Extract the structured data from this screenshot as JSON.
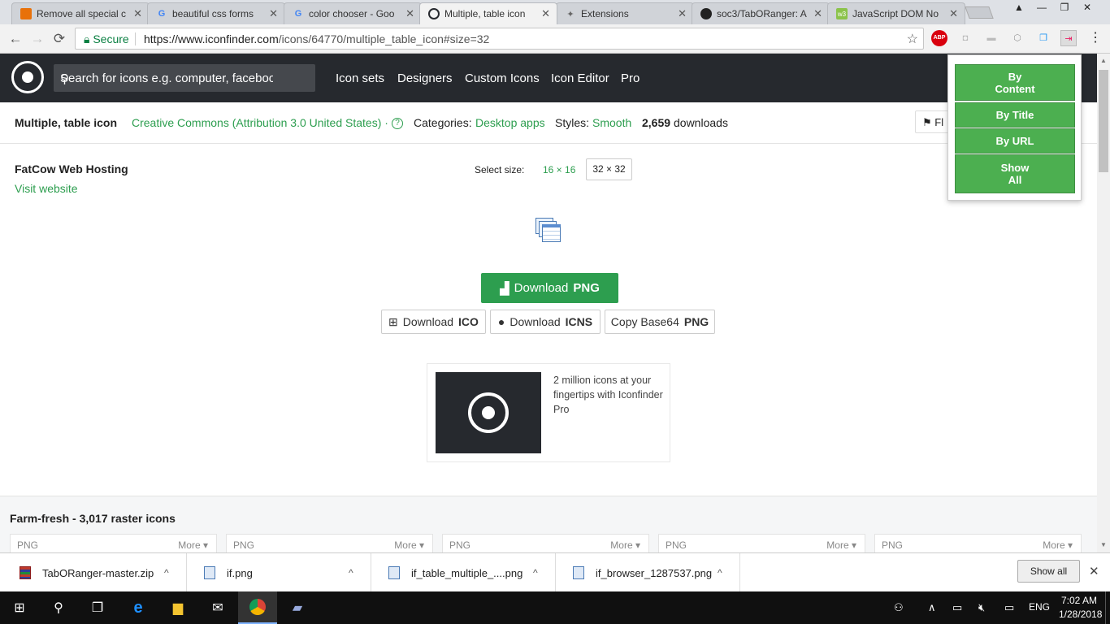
{
  "tabs": [
    {
      "label": "Remove all special c",
      "favicon": "",
      "color": "#e8710a"
    },
    {
      "label": "beautiful css forms",
      "favicon": "G",
      "color": "#4285f4"
    },
    {
      "label": "color chooser - Goo",
      "favicon": "G",
      "color": "#4285f4"
    },
    {
      "label": "Multiple, table icon",
      "favicon": "",
      "color": "#26292e"
    },
    {
      "label": "Extensions",
      "favicon": "✦",
      "color": "#666666"
    },
    {
      "label": "soc3/TabORanger: A",
      "favicon": "",
      "color": "#222222"
    },
    {
      "label": "JavaScript DOM No",
      "favicon": "w3",
      "color": "#8bc34a"
    }
  ],
  "window": {
    "minimize": "—",
    "maximize": "❐",
    "close": "✕"
  },
  "toolbar": {
    "back": "←",
    "forward": "→",
    "reload": "⟳",
    "secure_label": "Secure",
    "url_host": "https://www.iconfinder.com",
    "url_path": "/icons/64770/multiple_table_icon#size=32",
    "star": "☆",
    "abp": "ABP",
    "menu": "⋮"
  },
  "site": {
    "search_placeholder": "Search for icons e.g. computer, faceboo",
    "nav": [
      "Icon sets",
      "Designers",
      "Custom Icons",
      "Icon Editor",
      "Pro"
    ]
  },
  "info": {
    "icon_title": "Multiple, table icon",
    "license": "Creative Commons (Attribution 3.0 United States) ·",
    "help": "?",
    "categories_label": "Categories:",
    "categories_value": "Desktop apps",
    "styles_label": "Styles:",
    "styles_value": "Smooth",
    "downloads_count": "2,659",
    "downloads_label": "downloads",
    "flag_label": "Fl"
  },
  "author": {
    "name": "FatCow Web Hosting",
    "link": "Visit website"
  },
  "size": {
    "label": "Select size:",
    "options": [
      "16 × 16",
      "32 × 32"
    ],
    "selected": "32 × 32"
  },
  "downloads": {
    "png_prefix": "Download",
    "png_bold": "PNG",
    "ico_prefix": "Download",
    "ico_bold": "ICO",
    "icns_prefix": "Download",
    "icns_bold": "ICNS",
    "base64_prefix": "Copy Base64",
    "base64_bold": "PNG"
  },
  "promo": {
    "text": "2 million icons at your fingertips with Iconfinder Pro"
  },
  "iconset": {
    "title_name": "Farm-fresh",
    "title_rest": " - 3,017 raster icons",
    "cards": [
      {
        "type": "PNG",
        "more": "More"
      },
      {
        "type": "PNG",
        "more": "More"
      },
      {
        "type": "PNG",
        "more": "More"
      },
      {
        "type": "PNG",
        "more": "More"
      },
      {
        "type": "PNG",
        "more": "More"
      }
    ]
  },
  "popup": {
    "buttons": [
      "By Content",
      "By Title",
      "By URL",
      "Show All"
    ]
  },
  "download_bar": {
    "items": [
      "TabORanger-master.zip",
      "if.png",
      "if_table_multiple_....png",
      "if_browser_1287537.png"
    ],
    "caret": "^",
    "show_all": "Show all",
    "close": "✕"
  },
  "taskbar": {
    "time": "7:02 AM",
    "date": "1/28/2018",
    "lang": "ENG"
  },
  "colors": {
    "accent_green": "#2d9e4f",
    "popup_green": "#4caf50",
    "nav_dark": "#26292e"
  }
}
